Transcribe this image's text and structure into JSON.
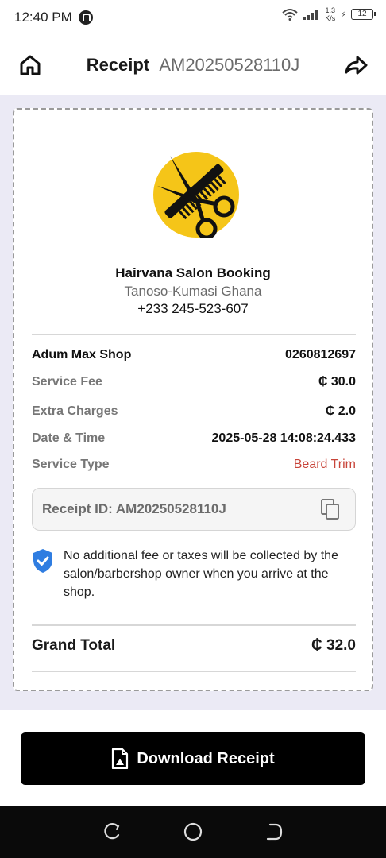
{
  "status_bar": {
    "time": "12:40 PM",
    "speed_value": "1.3",
    "speed_unit": "K/s",
    "battery": "12"
  },
  "header": {
    "title": "Receipt",
    "receipt_code": "AM20250528110J"
  },
  "salon": {
    "name": "Hairvana Salon Booking",
    "location": "Tanoso-Kumasi Ghana",
    "phone": "+233 245-523-607"
  },
  "details": {
    "shop_name": "Adum Max Shop",
    "shop_number": "0260812697",
    "service_fee_label": "Service Fee",
    "service_fee_value": "₵ 30.0",
    "extra_charges_label": "Extra Charges",
    "extra_charges_value": "₵ 2.0",
    "datetime_label": "Date & Time",
    "datetime_value": "2025-05-28 14:08:24.433",
    "service_type_label": "Service Type",
    "service_type_value": "Beard Trim"
  },
  "receipt_id": {
    "text": "Receipt ID: AM20250528110J"
  },
  "notice": {
    "text": "No additional fee or taxes will be collected by the salon/barbershop owner when you arrive at the shop."
  },
  "total": {
    "label": "Grand Total",
    "value": "₵ 32.0"
  },
  "download": {
    "label": "Download Receipt"
  },
  "colors": {
    "accent_red": "#c8453a",
    "shield_blue": "#2f7de1",
    "logo_yellow": "#f5c518",
    "background_panel": "#ebeaf5"
  },
  "icons": [
    "home-icon",
    "share-icon",
    "copy-icon",
    "shield-check-icon",
    "document-icon",
    "recent-apps-icon",
    "home-nav-icon",
    "back-nav-icon"
  ]
}
